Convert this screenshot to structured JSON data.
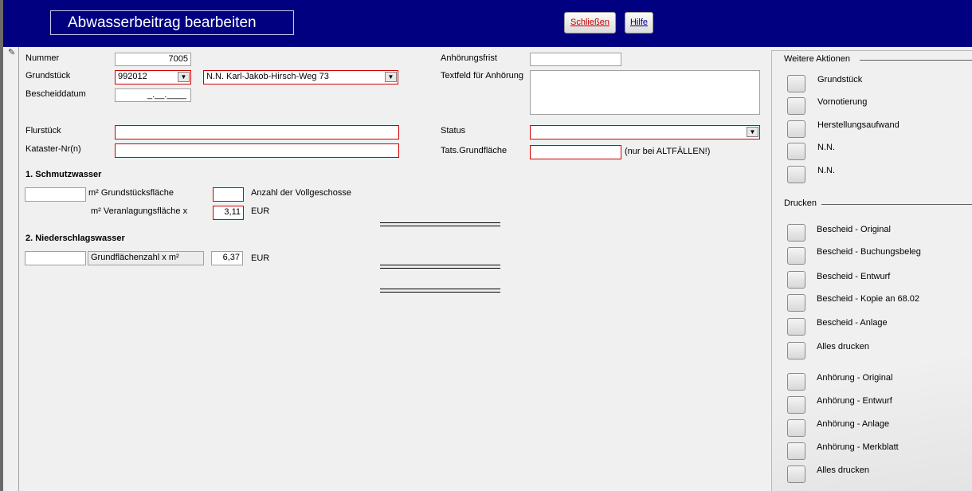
{
  "header": {
    "title": "Abwasserbeitrag bearbeiten",
    "close_label": "Schließen",
    "help_label": "Hilfe"
  },
  "form": {
    "nummer_label": "Nummer",
    "nummer_value": "7005",
    "grundstueck_label": "Grundstück",
    "grundstueck_value": "992012",
    "grundstueck_name": "N.N. Karl-Jakob-Hirsch-Weg 73",
    "bescheiddatum_label": "Bescheiddatum",
    "bescheiddatum_value": "_.__.____",
    "flurstueck_label": "Flurstück",
    "flurstueck_value": "",
    "kataster_label": "Kataster-Nr(n)",
    "kataster_value": "",
    "anhoerungsfrist_label": "Anhörungsfrist",
    "anhoerungsfrist_value": "",
    "textfeld_label": "Textfeld für Anhörung",
    "textfeld_value": "",
    "status_label": "Status",
    "status_value": "",
    "grundflaeche_label": "Tats.Grundfläche",
    "grundflaeche_value": "",
    "grundflaeche_note": "(nur bei ALTFÄLLEN!)"
  },
  "schmutzwasser": {
    "heading": "1. Schmutzwasser",
    "flaeche_value": "",
    "flaeche_label": "m² Grundstücksfläche",
    "vollgeschosse_value": "",
    "vollgeschosse_label": "Anzahl der Vollgeschosse",
    "veranlagung_label": "m² Veranlagungsfläche x",
    "rate": "3,11",
    "currency": "EUR"
  },
  "niederschlagswasser": {
    "heading": "2. Niederschlagswasser",
    "value": "",
    "grundflaechenzahl_label": "Grundflächenzahl x m²",
    "rate": "6,37",
    "currency": "EUR"
  },
  "weitere_aktionen": {
    "title": "Weitere Aktionen",
    "items": [
      "Grundstück",
      "Vornotierung",
      "Herstellungsaufwand",
      "N.N.",
      "N.N."
    ]
  },
  "drucken": {
    "title": "Drucken",
    "items": [
      "Bescheid - Original",
      "Bescheid - Buchungsbeleg",
      "Bescheid - Entwurf",
      "Bescheid - Kopie an 68.02",
      "Bescheid - Anlage",
      "Alles drucken",
      "Anhörung - Original",
      "Anhörung - Entwurf",
      "Anhörung - Anlage",
      "Anhörung - Merkblatt",
      "Alles drucken"
    ]
  },
  "icons": {
    "edit_record": "pencil-icon",
    "dropdown": "chevron-down-icon"
  },
  "colors": {
    "header_bg": "#000080",
    "required_border": "#d00000",
    "close_text": "#c00000"
  }
}
